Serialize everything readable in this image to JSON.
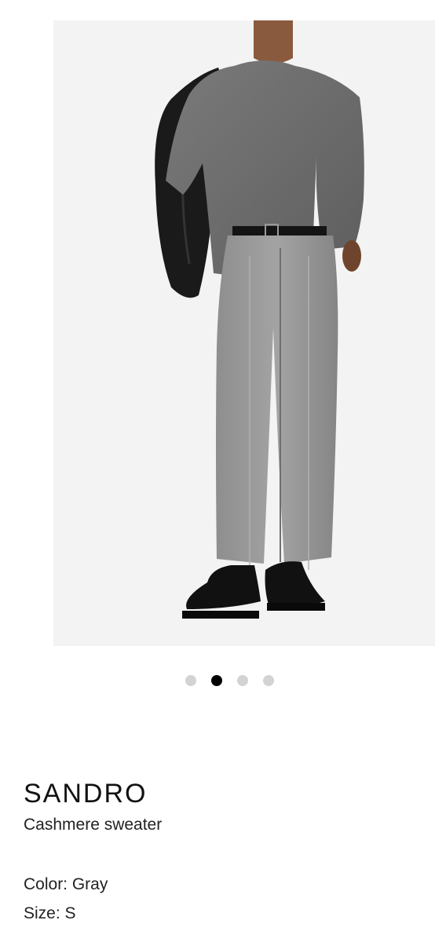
{
  "product_image": {
    "alt": "Model wearing gray cashmere sweater with gray trousers and black shoes",
    "background": "#f3f3f3"
  },
  "carousel": {
    "count": 4,
    "active_index": 1
  },
  "product": {
    "brand": "SANDRO",
    "name": "Cashmere sweater",
    "color_text": "Color: Gray",
    "size_text": "Size: S"
  },
  "colors": {
    "dot_inactive": "#d3d3d3",
    "dot_active": "#000000"
  }
}
